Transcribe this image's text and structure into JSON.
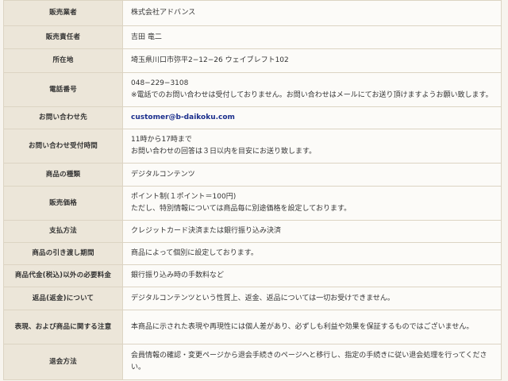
{
  "rows": [
    {
      "label": "販売業者",
      "lines": [
        "株式会社アドバンス"
      ]
    },
    {
      "label": "販売責任者",
      "lines": [
        "吉田 竜二"
      ]
    },
    {
      "label": "所在地",
      "lines": [
        "埼玉県川口市弥平2−12−26 ウェイブレフト102"
      ]
    },
    {
      "label": "電話番号",
      "lines": [
        "048−229−3108",
        "※電話でのお問い合わせは受付しておりません。お問い合わせはメールにてお送り頂けますようお願い致します。"
      ]
    },
    {
      "label": "お問い合わせ先",
      "lines": [
        "customer@b-daikoku.com"
      ]
    },
    {
      "label": "お問い合わせ受付時間",
      "lines": [
        "11時から17時まで",
        "お問い合わせの回答は３日以内を目安にお送り致します。"
      ]
    },
    {
      "label": "商品の種類",
      "lines": [
        "デジタルコンテンツ"
      ]
    },
    {
      "label": "販売価格",
      "lines": [
        "ポイント制(１ポイント＝100円)",
        "ただし、特別情報については商品毎に別途価格を設定しております。"
      ]
    },
    {
      "label": "支払方法",
      "lines": [
        "クレジットカード決済または銀行振り込み決済"
      ]
    },
    {
      "label": "商品の引き渡し期間",
      "lines": [
        "商品によって個別に設定しております。"
      ]
    },
    {
      "label": "商品代金(税込)以外の必要料金",
      "lines": [
        "銀行振り込み時の手数料など"
      ]
    },
    {
      "label": "返品(返金)について",
      "lines": [
        "デジタルコンテンツという性質上、返金、返品については一切お受けできません。"
      ]
    },
    {
      "label": "表現、および商品に関する注意",
      "lines": [
        "本商品に示された表現や再現性には個人差があり、必ずしも利益や効果を保証するものではございません。"
      ]
    },
    {
      "label": "退会方法",
      "lines": [
        "会員情報の確認・変更ページから退会手続きのページへと移行し、指定の手続きに従い退会処理を行ってください。"
      ]
    }
  ]
}
